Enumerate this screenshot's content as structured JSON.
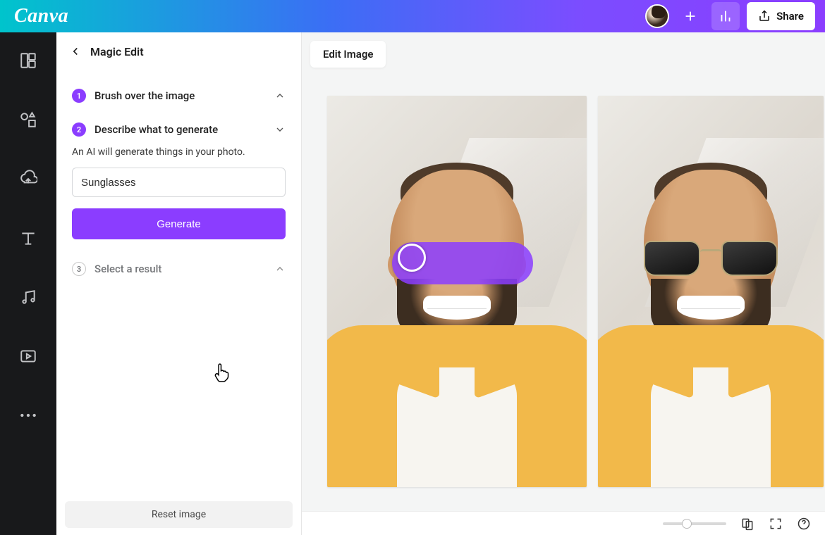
{
  "brand": "Canva",
  "top": {
    "share_label": "Share"
  },
  "sidepanel": {
    "title": "Magic Edit",
    "step1": {
      "num": "1",
      "label": "Brush over the image"
    },
    "step2": {
      "num": "2",
      "label": "Describe what to generate",
      "hint": "An AI will generate things in your photo.",
      "input_value": "Sunglasses",
      "generate": "Generate"
    },
    "step3": {
      "num": "3",
      "label": "Select a result"
    },
    "reset": "Reset image"
  },
  "canvas": {
    "floating_label": "Edit Image"
  }
}
